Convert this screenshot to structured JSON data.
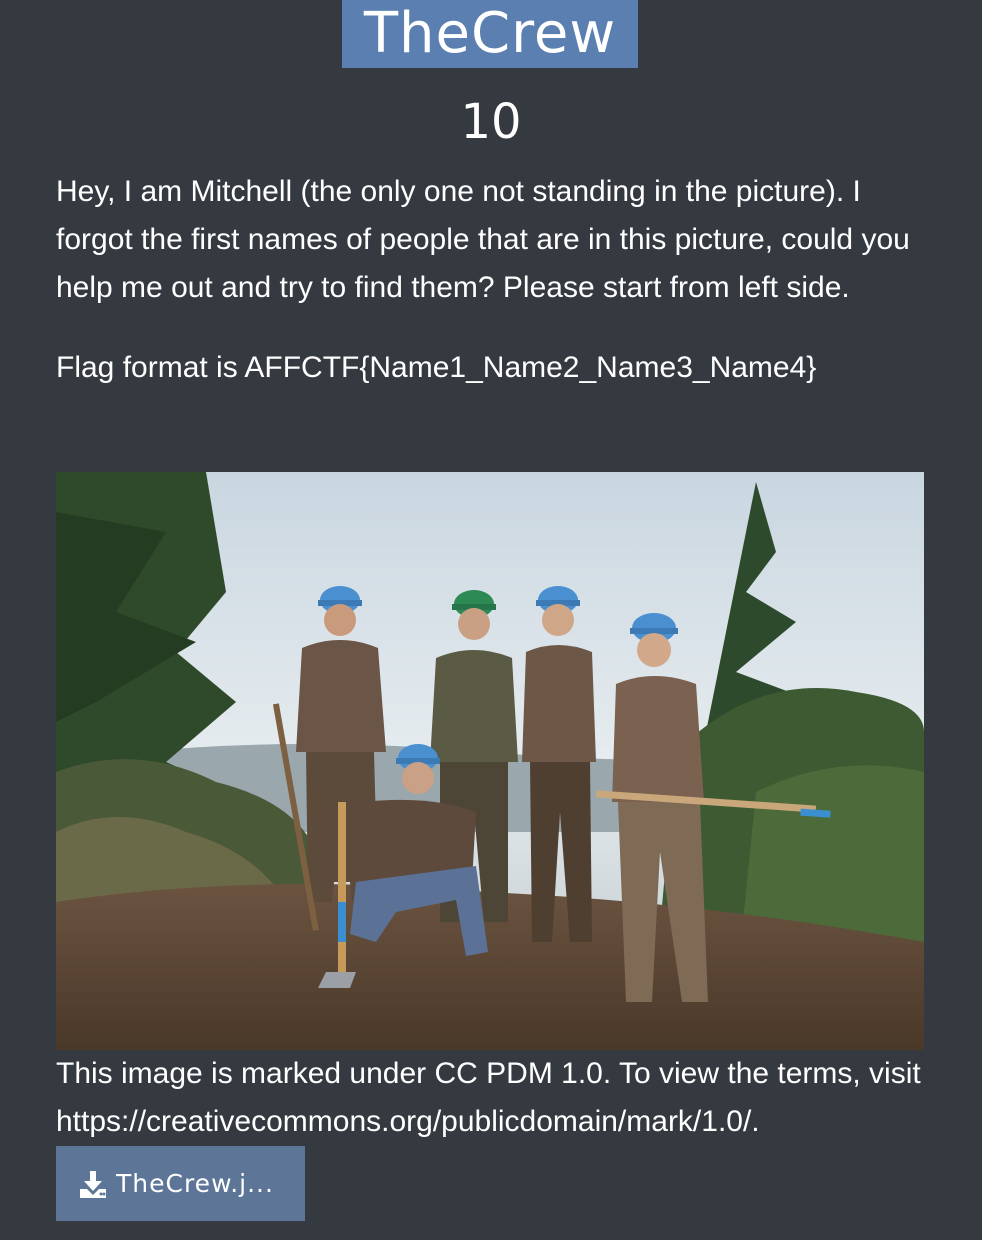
{
  "challenge": {
    "name": "TheCrew",
    "points": "10",
    "description": [
      "Hey, I am Mitchell (the only one not standing in the picture). I forgot the first names of people that are in this picture, could you help me out and try to find them? Please start from left side.",
      "Flag format is AFFCTF{Name1_Name2_Name3_Name4}"
    ],
    "license": "This image is marked under CC PDM 1.0. To view the terms, visit https://creativecommons.org/publicdomain/mark/1.0/.",
    "download": {
      "label": "TheCrew.j...",
      "icon": "download-icon"
    }
  },
  "colors": {
    "background": "#343a40",
    "title_bg": "#5a7fb0",
    "download_bg": "#5d7697",
    "text": "#ffffff"
  }
}
